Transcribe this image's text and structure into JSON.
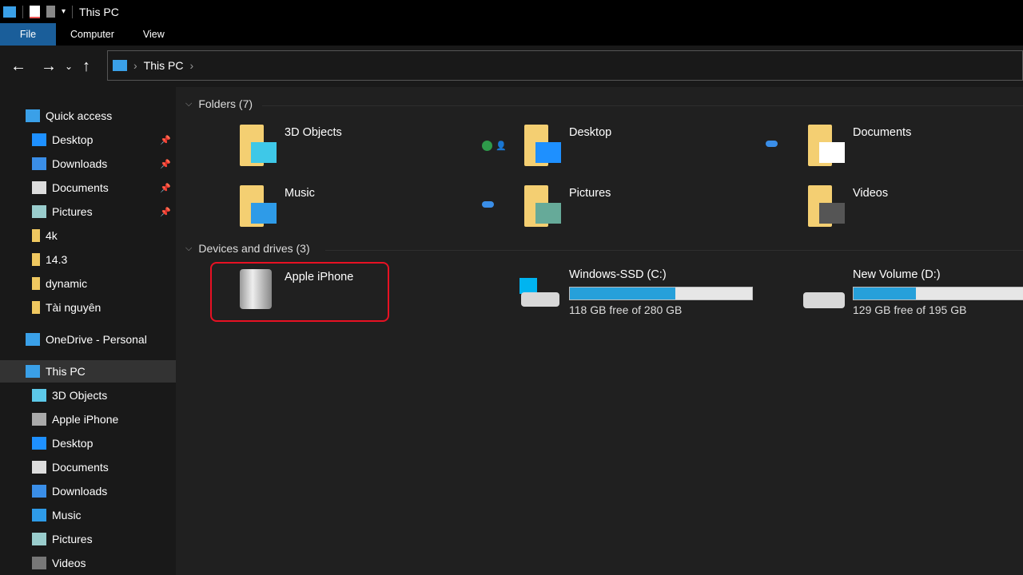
{
  "window": {
    "title": "This PC"
  },
  "ribbon": {
    "tabs": [
      "File",
      "Computer",
      "View"
    ]
  },
  "address": {
    "path": [
      "This PC"
    ]
  },
  "sidebar": {
    "items": [
      {
        "label": "Quick access",
        "icon": "star-icon",
        "pinned": false
      },
      {
        "label": "Desktop",
        "icon": "desktop-icon",
        "pinned": true
      },
      {
        "label": "Downloads",
        "icon": "download-icon",
        "pinned": true
      },
      {
        "label": "Documents",
        "icon": "document-icon",
        "pinned": true
      },
      {
        "label": "Pictures",
        "icon": "pictures-icon",
        "pinned": true
      },
      {
        "label": "4k",
        "icon": "folder-icon",
        "pinned": false
      },
      {
        "label": "14.3",
        "icon": "folder-icon",
        "pinned": false
      },
      {
        "label": "dynamic",
        "icon": "folder-icon",
        "pinned": false
      },
      {
        "label": "Tài nguyên",
        "icon": "folder-icon",
        "pinned": false
      },
      {
        "label": "OneDrive - Personal",
        "icon": "cloud-icon",
        "pinned": false
      },
      {
        "label": "This PC",
        "icon": "computer-icon",
        "pinned": false,
        "selected": true
      },
      {
        "label": "3D Objects",
        "icon": "cube-icon",
        "pinned": false
      },
      {
        "label": "Apple iPhone",
        "icon": "phone-device-icon",
        "pinned": false
      },
      {
        "label": "Desktop",
        "icon": "desktop-icon",
        "pinned": false
      },
      {
        "label": "Documents",
        "icon": "document-icon",
        "pinned": false
      },
      {
        "label": "Downloads",
        "icon": "download-icon",
        "pinned": false
      },
      {
        "label": "Music",
        "icon": "music-icon",
        "pinned": false
      },
      {
        "label": "Pictures",
        "icon": "pictures-icon",
        "pinned": false
      },
      {
        "label": "Videos",
        "icon": "video-icon",
        "pinned": false
      }
    ]
  },
  "folders": {
    "header": "Folders (7)",
    "items": [
      {
        "name": "3D Objects",
        "overlay": "cube"
      },
      {
        "name": "Desktop",
        "overlay": "desktop"
      },
      {
        "name": "Documents",
        "overlay": "document"
      },
      {
        "name": "Music",
        "overlay": "music"
      },
      {
        "name": "Pictures",
        "overlay": "picture"
      },
      {
        "name": "Videos",
        "overlay": "video"
      }
    ]
  },
  "devices": {
    "header": "Devices and drives (3)",
    "items": [
      {
        "name": "Apple iPhone",
        "type": "device"
      },
      {
        "name": "Windows-SSD (C:)",
        "free": "118 GB free of 280 GB",
        "used_fraction": 0.58
      },
      {
        "name": "New Volume (D:)",
        "free": "129 GB free of 195 GB",
        "used_fraction": 0.34
      }
    ]
  },
  "colors": {
    "accent": "#26a0da",
    "highlight": "#e81123",
    "file_tab": "#1a5e9a"
  }
}
